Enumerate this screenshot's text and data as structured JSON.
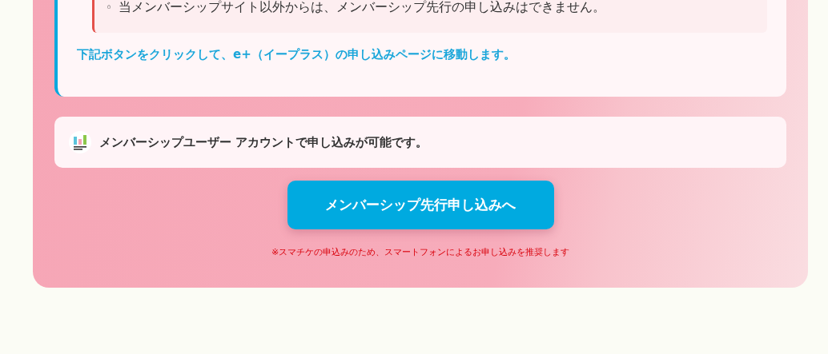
{
  "notice": {
    "notes": [
      {
        "marker": "◦",
        "text": "当メンバーシップサイト以外からは、メンバーシップ先行の申し込みはできません。"
      }
    ],
    "link_text": "下記ボタンをクリックして、e+（イープラス）の申し込みページに移動します。"
  },
  "account_info": {
    "text": "メンバーシップユーザー アカウントで申し込みが可能です。"
  },
  "apply_button": {
    "label": "メンバーシップ先行申し込みへ"
  },
  "footnote": "※スマチケの申込みのため、スマートフォンによるお申し込みを推奨します"
}
